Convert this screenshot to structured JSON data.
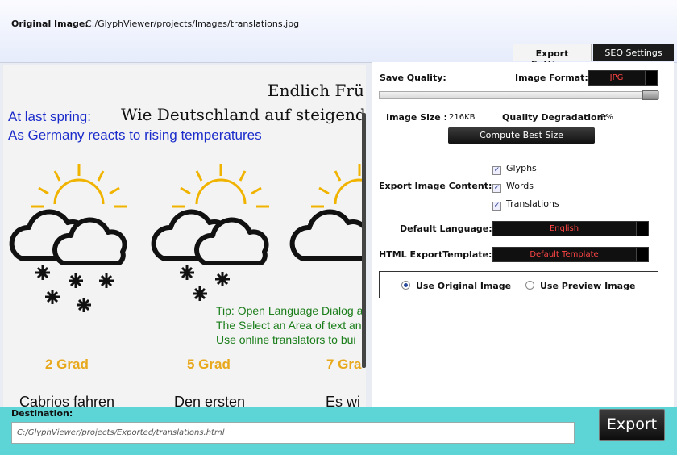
{
  "header": {
    "original_image_label": "Original Image:",
    "original_image_path": "C:/GlyphViewer/projects/Images/translations.jpg"
  },
  "tabs": [
    {
      "label": "Export Settings",
      "active": true
    },
    {
      "label": "SEO Settings",
      "active": false
    }
  ],
  "preview": {
    "title_line1": "Endlich Frü",
    "title_line2": "Wie Deutschland auf steigend",
    "translation_line1": "At last spring:",
    "translation_line2": "As Germany reacts to rising temperatures",
    "tip_line1": "Tip: Open Language Dialog a",
    "tip_line2": "The Select an Area of text an",
    "tip_line3": "Use online translators to bui",
    "grades": [
      "2 Grad",
      "5 Grad",
      "7 Gra"
    ],
    "bottom_texts": [
      "Cabrios fahren",
      "Den ersten",
      "Es wi"
    ],
    "weather_icons": [
      "snow-cloud-icon",
      "snow-cloud-icon",
      "snow-cloud-icon"
    ]
  },
  "settings": {
    "save_quality_label": "Save Quality:",
    "save_quality_value": 1.0,
    "image_format_label": "Image Format:",
    "image_format_value": "JPG",
    "image_size_label": "Image Size :",
    "image_size_value": "216KB",
    "quality_degradation_label": "Quality Degradation:",
    "quality_degradation_value": "3%",
    "compute_button_label": "Compute Best Size",
    "export_content_label": "Export Image Content:",
    "content_options": [
      {
        "label": "Glyphs",
        "checked": true
      },
      {
        "label": "Words",
        "checked": true
      },
      {
        "label": "Translations",
        "checked": true
      }
    ],
    "default_language_label": "Default Language:",
    "default_language_value": "English",
    "html_template_label": "HTML ExportTemplate:",
    "html_template_value": "Default Template",
    "radio_options": [
      {
        "label": "Use Original Image",
        "selected": true
      },
      {
        "label": "Use Preview Image",
        "selected": false
      }
    ]
  },
  "footer": {
    "destination_label": "Destination:",
    "destination_value": "C:/GlyphViewer/projects/Exported/translations.html",
    "export_button_label": "Export"
  },
  "colors": {
    "accent_teal": "#5dd5d6",
    "select_text_red": "#ff4545",
    "translation_blue": "#1b2ccb",
    "tip_green": "#1a7d1a",
    "grade_orange": "#e8a81b"
  }
}
